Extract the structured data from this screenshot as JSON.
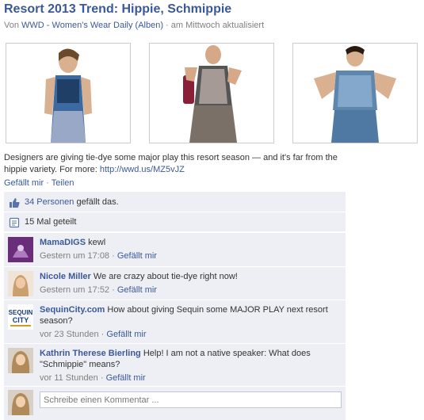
{
  "post": {
    "title": "Resort 2013 Trend: Hippie, Schmippie",
    "meta_prefix": "Von ",
    "author": "WWD - Women's Wear Daily",
    "albums": "(Alben)",
    "meta_suffix": " · am Mittwoch aktualisiert",
    "description": "Designers are giving tie-dye some major play this resort season — and it's far from the hippie variety. For more: ",
    "link": "http://wwd.us/MZ5vJZ",
    "like_action": "Gefällt mir",
    "action_sep": " · ",
    "share_action": "Teilen"
  },
  "photos": [
    {
      "name": "photo-model-1",
      "dress": "#3a6aa0",
      "accent": "#9aa8c8"
    },
    {
      "name": "photo-model-2",
      "dress": "#555555",
      "accent": "#c8b8b0"
    },
    {
      "name": "photo-model-3",
      "dress": "#5f86ad",
      "accent": "#9dc0df"
    }
  ],
  "ufi": {
    "likes_count": "34 Personen",
    "likes_suffix": " gefällt das.",
    "shares": "15 Mal geteilt"
  },
  "comments": [
    {
      "author": "MamaDIGS",
      "text": " kewl",
      "time": "Gestern um 17:08",
      "like": "Gefällt mir",
      "avatar_color": "#6a2d7a"
    },
    {
      "author": "Nicole Miller",
      "text": " We are crazy about tie-dye right now!",
      "time": "Gestern um 17:52",
      "like": "Gefällt mir",
      "avatar_color": "#c9a070"
    },
    {
      "author": "SequinCity.com",
      "text": " How about giving Sequin some MAJOR PLAY next resort season?",
      "time": "vor 23 Stunden",
      "like": "Gefällt mir",
      "avatar_color": "#1a3c7a",
      "avatar_text": "SEQUIN CITY"
    },
    {
      "author": "Kathrin Therese Bierling",
      "text": " Help! I am not a native speaker: What does \"Schmippie\" means?",
      "time": "vor 11 Stunden",
      "like": "Gefällt mir",
      "avatar_color": "#b08a5a"
    }
  ],
  "compose": {
    "placeholder": "Schreibe einen Kommentar ..."
  },
  "colors": {
    "link": "#3b5998",
    "ufi_bg": "#edeff4",
    "muted": "#808080"
  }
}
